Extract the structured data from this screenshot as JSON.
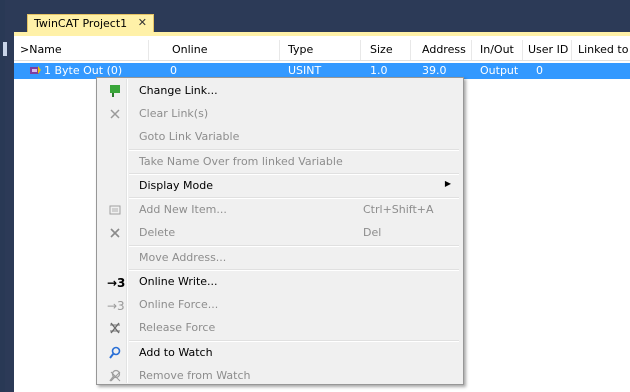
{
  "tab": {
    "title": "TwinCAT Project1",
    "close_glyph": "✕"
  },
  "columns": [
    {
      "label": ">Name"
    },
    {
      "label": "Online"
    },
    {
      "label": "Type"
    },
    {
      "label": "Size"
    },
    {
      "label": "Address"
    },
    {
      "label": "In/Out"
    },
    {
      "label": "User ID"
    },
    {
      "label": "Linked to"
    }
  ],
  "row": {
    "name": "1 Byte Out (0)",
    "online": "0",
    "type": "USINT",
    "size": "1.0",
    "address": "39.0",
    "inout": "Output",
    "userid": "0"
  },
  "menu": {
    "change_link": "Change Link...",
    "clear_links": "Clear Link(s)",
    "goto_link": "Goto Link Variable",
    "take_name": "Take Name Over from linked Variable",
    "display_mode": "Display Mode",
    "add_new_item": "Add New Item...",
    "add_new_item_shortcut": "Ctrl+Shift+A",
    "delete": "Delete",
    "delete_shortcut": "Del",
    "move_address": "Move Address...",
    "online_write": "Online Write...",
    "online_force": "Online Force...",
    "release_force": "Release Force",
    "add_watch": "Add to Watch",
    "remove_watch": "Remove from Watch",
    "write_icon_glyph": "→3",
    "force_icon_glyph": "→3"
  },
  "colors": {
    "frame": "#2c3a57",
    "tab_active": "#fff1a8",
    "selection": "#3399ff",
    "menu_bg": "#f0f0f0"
  },
  "icons": {
    "link": "change-link-icon",
    "clear": "clear-link-icon",
    "add_item": "add-item-icon",
    "delete": "delete-icon",
    "write": "online-write-icon",
    "force": "online-force-icon",
    "release": "release-force-icon",
    "watch": "add-watch-icon",
    "unwatch": "remove-watch-icon"
  }
}
